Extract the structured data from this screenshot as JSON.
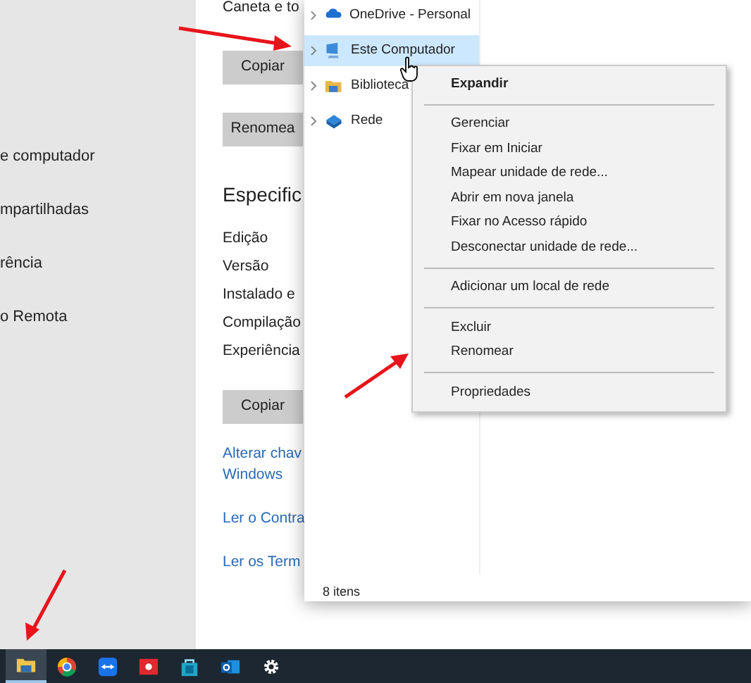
{
  "settings_sidebar": {
    "items": [
      {
        "label": "e computador"
      },
      {
        "label": "mpartilhadas"
      },
      {
        "label": "rência"
      },
      {
        "label": "o Remota"
      }
    ]
  },
  "settings_content": {
    "top_text": "Caneta e to",
    "buttons": [
      "Copiar",
      "Renomea"
    ],
    "heading": "Especific",
    "spec_labels": [
      "Edição",
      "Versão",
      "Instalado e",
      "Compilação",
      "Experiência"
    ],
    "copy_button": "Copiar",
    "links": [
      {
        "lines": [
          "Alterar chav",
          "Windows"
        ]
      },
      {
        "lines": [
          "Ler o Contra"
        ]
      },
      {
        "lines": [
          "Ler os Term"
        ]
      }
    ]
  },
  "explorer": {
    "nav_items": [
      {
        "kind": "cloud",
        "label": "OneDrive - Personal",
        "selected": false
      },
      {
        "kind": "computer",
        "label": "Este Computador",
        "selected": true
      },
      {
        "kind": "library",
        "label": "Biblioteca",
        "selected": false
      },
      {
        "kind": "network",
        "label": "Rede",
        "selected": false
      }
    ],
    "status": "8 itens"
  },
  "context_menu": {
    "groups": [
      [
        {
          "label": "Expandir",
          "default": true
        }
      ],
      [
        {
          "label": "Gerenciar",
          "default": false
        },
        {
          "label": "Fixar em Iniciar",
          "default": false
        },
        {
          "label": "Mapear unidade de rede...",
          "default": false
        },
        {
          "label": "Abrir em nova janela",
          "default": false
        },
        {
          "label": "Fixar no Acesso rápido",
          "default": false
        },
        {
          "label": "Desconectar unidade de rede...",
          "default": false
        }
      ],
      [
        {
          "label": "Adicionar um local de rede",
          "default": false
        }
      ],
      [
        {
          "label": "Excluir",
          "default": false
        },
        {
          "label": "Renomear",
          "default": false
        }
      ],
      [
        {
          "label": "Propriedades",
          "default": false
        }
      ]
    ]
  },
  "taskbar": {
    "items": [
      {
        "kind": "folder",
        "active": true
      },
      {
        "kind": "browser",
        "active": false
      },
      {
        "kind": "remote",
        "active": false
      },
      {
        "kind": "recorder",
        "active": false
      },
      {
        "kind": "store",
        "active": false
      },
      {
        "kind": "mail",
        "active": false
      },
      {
        "kind": "gear",
        "active": false
      }
    ]
  }
}
